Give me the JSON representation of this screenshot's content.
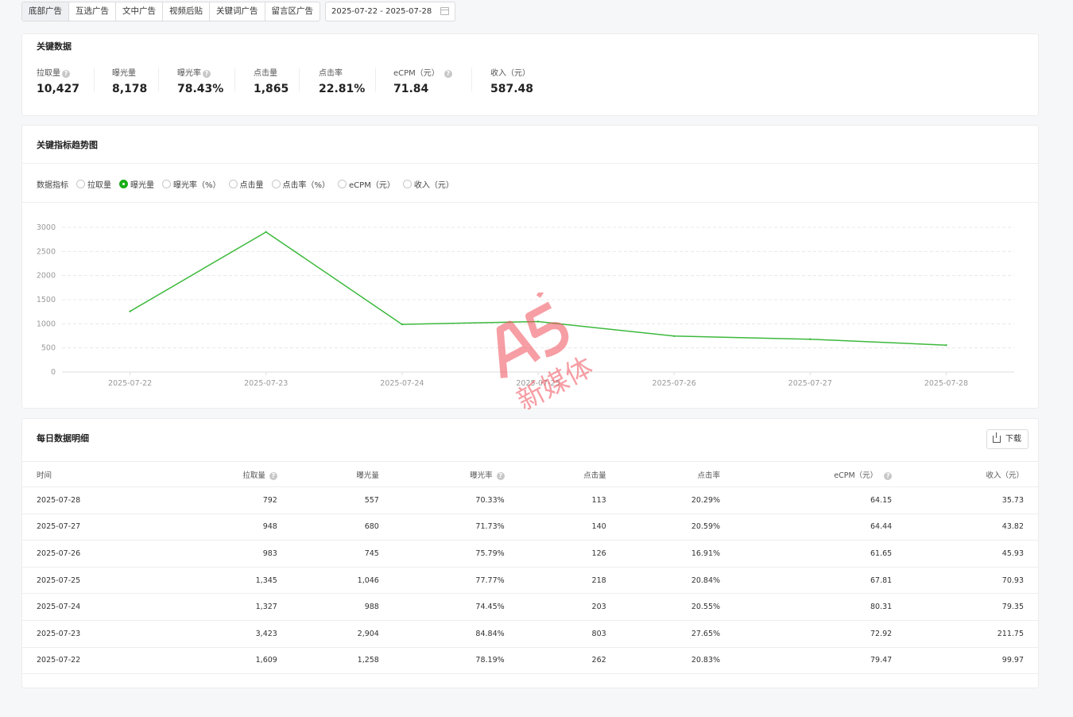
{
  "tabs": [
    "底部广告",
    "互选广告",
    "文中广告",
    "视频后贴",
    "关键词广告",
    "留言区广告"
  ],
  "date_range": "2025-07-22 - 2025-07-28",
  "key_data": {
    "title": "关键数据",
    "metrics": [
      {
        "label": "拉取量",
        "value": "10,427",
        "help": true
      },
      {
        "label": "曝光量",
        "value": "8,178",
        "help": false
      },
      {
        "label": "曝光率",
        "value": "78.43%",
        "help": true
      },
      {
        "label": "点击量",
        "value": "1,865",
        "help": false
      },
      {
        "label": "点击率",
        "value": "22.81%",
        "help": false
      },
      {
        "label": "eCPM（元）",
        "value": "71.84",
        "help": true
      },
      {
        "label": "收入（元）",
        "value": "587.48",
        "help": false
      }
    ]
  },
  "trend": {
    "title": "关键指标趋势图",
    "selector_label": "数据指标",
    "options": [
      "拉取量",
      "曝光量",
      "曝光率（%）",
      "点击量",
      "点击率（%）",
      "eCPM（元）",
      "收入（元）"
    ],
    "selected": "曝光量"
  },
  "chart_data": {
    "type": "line",
    "x": [
      "2025-07-22",
      "2025-07-23",
      "2025-07-24",
      "2025-07-25",
      "2025-07-26",
      "2025-07-27",
      "2025-07-28"
    ],
    "series": [
      {
        "values": [
          1258,
          2904,
          988,
          1046,
          745,
          680,
          557
        ],
        "color": "#3cb93c"
      }
    ],
    "y_ticks": [
      0,
      500,
      1000,
      1500,
      2000,
      2500,
      3000
    ],
    "ylim": [
      0,
      3000
    ],
    "grid": "dashed horizontal",
    "legend": "none"
  },
  "table": {
    "title": "每日数据明细",
    "download_label": "下载",
    "columns": [
      "时间",
      "拉取量",
      "曝光量",
      "曝光率",
      "点击量",
      "点击率",
      "eCPM（元）",
      "收入（元）"
    ],
    "column_help": [
      false,
      true,
      false,
      true,
      false,
      false,
      true,
      false
    ],
    "rows": [
      [
        "2025-07-28",
        "792",
        "557",
        "70.33%",
        "113",
        "20.29%",
        "64.15",
        "35.73"
      ],
      [
        "2025-07-27",
        "948",
        "680",
        "71.73%",
        "140",
        "20.59%",
        "64.44",
        "43.82"
      ],
      [
        "2025-07-26",
        "983",
        "745",
        "75.79%",
        "126",
        "16.91%",
        "61.65",
        "45.93"
      ],
      [
        "2025-07-25",
        "1,345",
        "1,046",
        "77.77%",
        "218",
        "20.84%",
        "67.81",
        "70.93"
      ],
      [
        "2025-07-24",
        "1,327",
        "988",
        "74.45%",
        "203",
        "20.55%",
        "80.31",
        "79.35"
      ],
      [
        "2025-07-23",
        "3,423",
        "2,904",
        "84.84%",
        "803",
        "27.65%",
        "72.92",
        "211.75"
      ],
      [
        "2025-07-22",
        "1,609",
        "1,258",
        "78.19%",
        "262",
        "20.83%",
        "79.47",
        "99.97"
      ]
    ]
  },
  "watermark": {
    "logo": "A5",
    "text": "新媒体",
    "color": "#f0505a"
  },
  "colors": {
    "accent": "#1aad19",
    "line": "#3cb93c"
  }
}
